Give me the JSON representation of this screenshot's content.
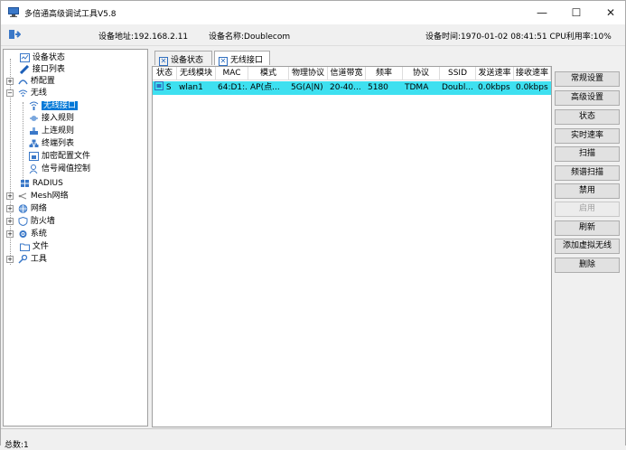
{
  "window": {
    "title": "多倍通高级调试工具V5.8",
    "minimize": "—",
    "maximize": "☐",
    "close": "✕"
  },
  "info": {
    "ip": "设备地址:192.168.2.11",
    "name": "设备名称:Doublecom",
    "time_cpu": "设备时间:1970-01-02 08:41:51  CPU利用率:10%"
  },
  "tree": [
    {
      "label": "设备状态",
      "icon": "device-status-icon"
    },
    {
      "label": "接口列表",
      "icon": "interface-list-icon"
    },
    {
      "label": "桥配置",
      "icon": "bridge-icon",
      "expander": "+"
    },
    {
      "label": "无线",
      "icon": "wireless-icon",
      "expander": "−"
    },
    {
      "label": "无线接口",
      "icon": "wireless-interface-icon",
      "selected": true
    },
    {
      "label": "接入规则",
      "icon": "access-rule-icon"
    },
    {
      "label": "上连规则",
      "icon": "uplink-rule-icon"
    },
    {
      "label": "终端列表",
      "icon": "terminal-list-icon"
    },
    {
      "label": "加密配置文件",
      "icon": "security-profile-icon"
    },
    {
      "label": "信号阈值控制",
      "icon": "signal-threshold-icon"
    },
    {
      "label": "RADIUS",
      "icon": "radius-icon"
    },
    {
      "label": "Mesh网络",
      "icon": "mesh-icon",
      "expander": "+"
    },
    {
      "label": "网络",
      "icon": "network-icon",
      "expander": "+"
    },
    {
      "label": "防火墙",
      "icon": "firewall-icon",
      "expander": "+"
    },
    {
      "label": "系统",
      "icon": "system-icon",
      "expander": "+"
    },
    {
      "label": "文件",
      "icon": "file-icon"
    },
    {
      "label": "工具",
      "icon": "tools-icon",
      "expander": "+"
    }
  ],
  "tabs": [
    {
      "label": "设备状态",
      "close": "✕"
    },
    {
      "label": "无线接口",
      "close": "✕"
    }
  ],
  "grid": {
    "columns": [
      "状态",
      "无线模块",
      "MAC",
      "模式",
      "物理协议",
      "信道带宽",
      "频率",
      "协议",
      "SSID",
      "发送速率",
      "接收速率"
    ],
    "rows": [
      [
        "S",
        "wlan1",
        "64:D1:...",
        "AP(点...",
        "5G(A|N)",
        "20-40...",
        "5180",
        "TDMA",
        "Doubl...",
        "0.0kbps",
        "0.0kbps"
      ]
    ]
  },
  "buttons": [
    {
      "label": "常规设置",
      "enabled": true
    },
    {
      "label": "高级设置",
      "enabled": true
    },
    {
      "label": "状态",
      "enabled": true
    },
    {
      "label": "实时速率",
      "enabled": true
    },
    {
      "label": "扫描",
      "enabled": true
    },
    {
      "label": "频谱扫描",
      "enabled": true
    },
    {
      "label": "禁用",
      "enabled": true
    },
    {
      "label": "启用",
      "enabled": false
    },
    {
      "label": "刷新",
      "enabled": true
    },
    {
      "label": "添加虚拟无线",
      "enabled": true
    },
    {
      "label": "删除",
      "enabled": true
    }
  ],
  "status": {
    "total": "总数:1"
  },
  "colors": {
    "row_selected": "#3ee0f0",
    "tree_selected": "#0078d7",
    "accent_blue": "#2f6fc0"
  }
}
